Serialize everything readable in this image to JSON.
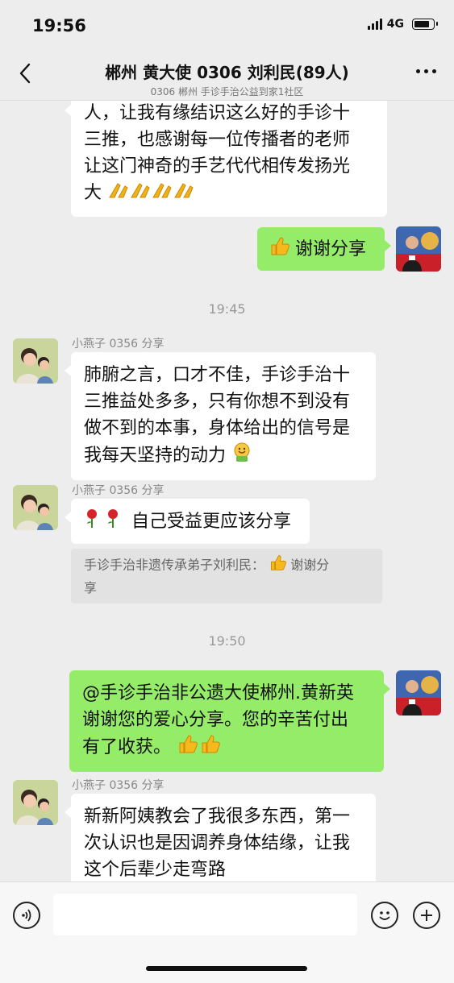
{
  "status_bar": {
    "time": "19:56",
    "network": "4G"
  },
  "header": {
    "title": "郴州 黄大使 0306 刘利民(89人)",
    "subtitle": "0306 郴州 手诊手治公益到家1社区"
  },
  "messages": {
    "m1_lines": [
      "人，让我有缘结识这么好的手诊十",
      "三推，也感谢每一位传播者的老师",
      "让这门神奇的手艺代代相传发扬光",
      "大"
    ],
    "m2_text": "谢谢分享",
    "ts1": "19:45",
    "m3_sender": "小燕子 0356 分享",
    "m3_lines": [
      "肺腑之言，口才不佳，手诊手治十",
      "三推益处多多，只有你想不到没有",
      "做不到的本事，身体给出的信号是",
      "我每天坚持的动力"
    ],
    "m4_sender": "小燕子 0356 分享",
    "m4_text": "自己受益更应该分享",
    "quote_name": "手诊手治非遗传承弟子刘利民：",
    "quote_text_a": "谢谢分",
    "quote_text_b": "享",
    "ts2": "19:50",
    "m5_lines": [
      "@手诊手治非公遗大使郴州.黄新英",
      "谢谢您的爱心分享。您的辛苦付出",
      "有了收获。"
    ],
    "m6_sender": "小燕子 0356 分享",
    "m6_lines": [
      "新新阿姨教会了我很多东西，第一",
      "次认识也是因调养身体结缘，让我",
      "这个后辈少走弯路"
    ]
  },
  "icons": {
    "back": "chevron-left-icon",
    "more": "more-dots-icon",
    "voice": "voice-icon",
    "emoji": "emoji-icon",
    "plus": "plus-icon"
  },
  "colors": {
    "accent_bubble": "#95ec69",
    "background": "#ededed"
  }
}
